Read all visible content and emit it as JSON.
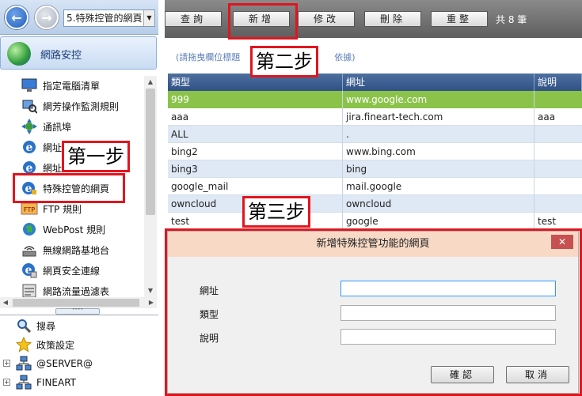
{
  "nav": {
    "breadcrumb": "5.特殊控管的網頁"
  },
  "section": {
    "title": "網路安控"
  },
  "tree": {
    "items": [
      {
        "label": "指定電腦清單",
        "icon": "monitor-icon"
      },
      {
        "label": "網芳操作監測規則",
        "icon": "network-monitor-icon"
      },
      {
        "label": "通訊埠",
        "icon": "port-icon"
      },
      {
        "label": "網址",
        "icon": "ie-icon"
      },
      {
        "label": "網址",
        "icon": "ie-icon"
      },
      {
        "label": "特殊控管的網頁",
        "icon": "ie-lock-icon"
      },
      {
        "label": "FTP 規則",
        "icon": "ftp-icon"
      },
      {
        "label": "WebPost 規則",
        "icon": "globe-icon"
      },
      {
        "label": "無線網路基地台",
        "icon": "wireless-icon"
      },
      {
        "label": "網頁安全連線",
        "icon": "ie-secure-icon"
      },
      {
        "label": "網路流量過濾表",
        "icon": "traffic-filter-icon"
      }
    ]
  },
  "bottom_tree": {
    "items": [
      {
        "label": "搜尋",
        "icon": "magnifier-icon"
      },
      {
        "label": "政策設定",
        "icon": "star-icon"
      },
      {
        "label": "@SERVER@",
        "icon": "server-group-icon"
      },
      {
        "label": "FINEART",
        "icon": "server-group-icon"
      }
    ]
  },
  "toolbar": {
    "query": "查詢",
    "add": "新增",
    "edit": "修改",
    "delete": "刪除",
    "reorder": "重整",
    "count": "共 8 筆"
  },
  "hint": {
    "text_left": "(請拖曳欄位標題",
    "text_right": "依據)"
  },
  "grid": {
    "columns": [
      "類型",
      "網址",
      "說明"
    ],
    "rows": [
      {
        "type": "999",
        "url": "www.google.com",
        "note": ""
      },
      {
        "type": "aaa",
        "url": "jira.fineart-tech.com",
        "note": "aaa"
      },
      {
        "type": "ALL",
        "url": ".",
        "note": ""
      },
      {
        "type": "bing2",
        "url": "www.bing.com",
        "note": ""
      },
      {
        "type": "bing3",
        "url": "bing",
        "note": ""
      },
      {
        "type": "google_mail",
        "url": "mail.google",
        "note": ""
      },
      {
        "type": "owncloud",
        "url": "owncloud",
        "note": ""
      },
      {
        "type": "test",
        "url": "google",
        "note": "test"
      }
    ]
  },
  "dialog": {
    "title": "新增特殊控管功能的網頁",
    "close": "✕",
    "fields": {
      "url": "網址",
      "type": "類型",
      "note": "說明"
    },
    "ok": "確認",
    "cancel": "取消"
  },
  "annotations": {
    "step1": "第一步",
    "step2": "第二步",
    "step3": "第三步"
  },
  "colors": {
    "annotation_red": "#e0161f",
    "selected_row": "#8bc34a",
    "grid_header": "#2f5185"
  }
}
